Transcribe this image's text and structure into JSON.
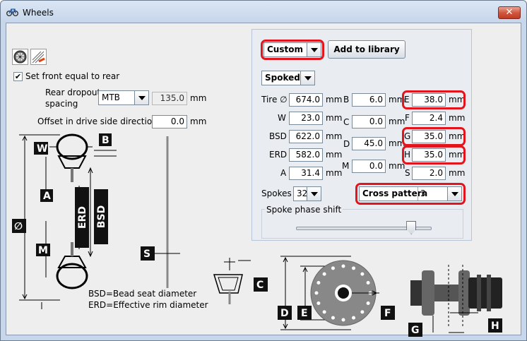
{
  "window": {
    "title": "Wheels",
    "close_label": "✕"
  },
  "left": {
    "set_front_equal_label": "Set front equal to rear",
    "set_front_equal_checked": "✔",
    "rear_dropout_label_1": "Rear dropout",
    "rear_dropout_label_2": "spacing",
    "dropout_combo": "MTB",
    "dropout_value": "135.0",
    "dropout_unit": "mm",
    "offset_label": "Offset in drive side direction",
    "offset_value": "0.0",
    "offset_unit": "mm",
    "diagram_labels": {
      "W": "W",
      "B": "B",
      "A": "A",
      "ERD": "ERD",
      "BSD": "BSD",
      "dia": "∅",
      "M": "M",
      "S": "S"
    },
    "legend_bsd": "BSD=Bead seat diameter",
    "legend_erd": "ERD=Effective rim diameter"
  },
  "right": {
    "library_combo": "Custom",
    "add_to_library": "Add to library",
    "wheel_type": "Spoked",
    "fields": {
      "tire_label": "Tire ∅",
      "tire": "674.0",
      "w_label": "W",
      "w": "23.0",
      "bsd_label": "BSD",
      "bsd": "622.0",
      "erd_label": "ERD",
      "erd": "582.0",
      "a_label": "A",
      "a": "31.4",
      "b_label": "B",
      "b": "6.0",
      "c_label": "C",
      "c": "0.0",
      "d_label": "D",
      "d": "45.0",
      "m_label": "M",
      "m": "0.0",
      "e_label": "E",
      "e": "38.0",
      "f_label": "F",
      "f": "2.4",
      "g_label": "G",
      "g": "35.0",
      "h_label": "H",
      "h": "35.0",
      "s_label": "S",
      "s": "2.0",
      "unit": "mm"
    },
    "spokes_label": "Spokes",
    "spokes_value": "32",
    "cross_pattern_label": "Cross pattern",
    "cross_pattern_value": "3",
    "phase_shift_label": "Spoke phase shift",
    "phase_shift_level": 0.85
  },
  "bottom": {
    "labels": {
      "C": "C",
      "D": "D",
      "E": "E",
      "F": "F",
      "G": "G",
      "H": "H"
    }
  },
  "colors": {
    "highlight": "#e3141b",
    "client_bg": "#eeeeee"
  }
}
